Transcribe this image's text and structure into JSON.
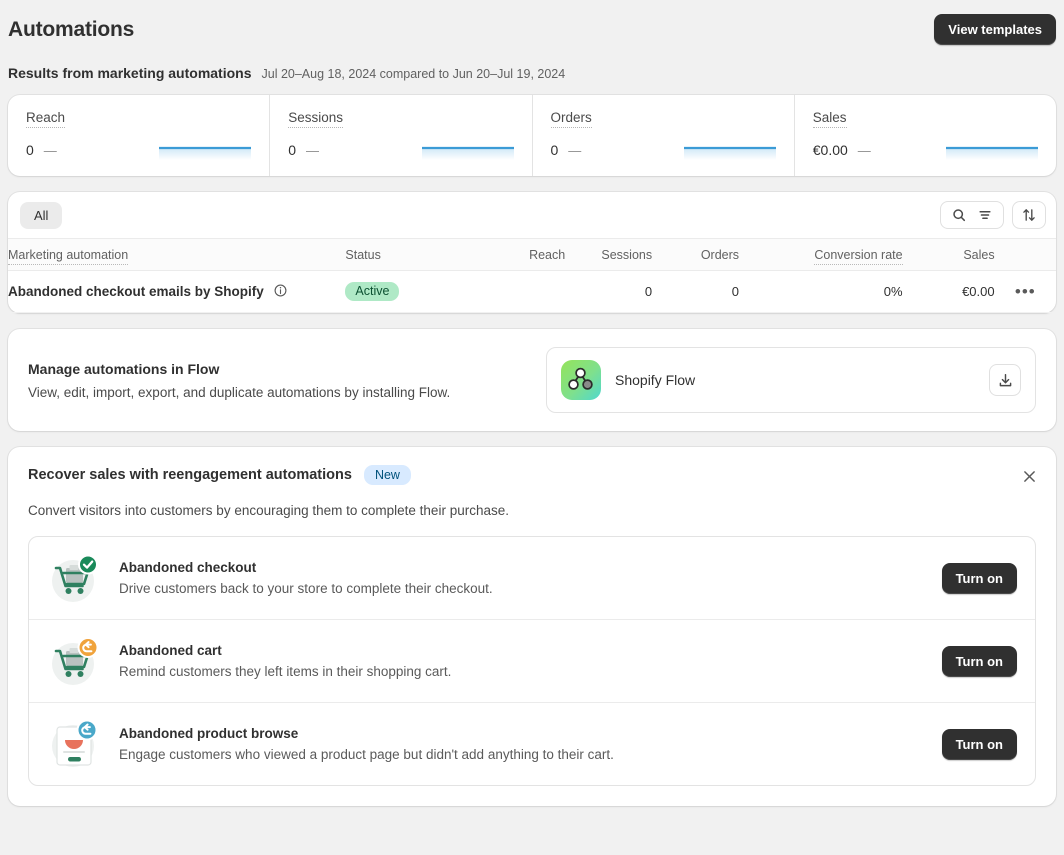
{
  "header": {
    "title": "Automations",
    "view_templates_label": "View templates"
  },
  "results": {
    "title": "Results from marketing automations",
    "date_range": "Jul 20–Aug 18, 2024 compared to Jun 20–Jul 19, 2024"
  },
  "metrics": [
    {
      "label": "Reach",
      "value": "0",
      "delta": "—"
    },
    {
      "label": "Sessions",
      "value": "0",
      "delta": "—"
    },
    {
      "label": "Orders",
      "value": "0",
      "delta": "—"
    },
    {
      "label": "Sales",
      "value": "€0.00",
      "delta": "—"
    }
  ],
  "table": {
    "tab_all": "All",
    "search_icon": "search-icon",
    "filter_icon": "filter-icon",
    "sort_icon": "sort-icon",
    "columns": {
      "name": "Marketing automation",
      "status": "Status",
      "reach": "Reach",
      "sessions": "Sessions",
      "orders": "Orders",
      "conversion_rate": "Conversion rate",
      "sales": "Sales"
    },
    "rows": [
      {
        "name": "Abandoned checkout emails by Shopify",
        "info_icon": "info-icon",
        "status": "Active",
        "reach": "",
        "sessions": "0",
        "orders": "0",
        "conversion_rate": "0%",
        "sales": "€0.00",
        "menu": "•••"
      }
    ]
  },
  "flow": {
    "title": "Manage automations in Flow",
    "subtitle": "View, edit, import, export, and duplicate automations by installing Flow.",
    "app_name": "Shopify Flow",
    "app_icon": "shopify-flow-icon",
    "download_icon": "download-icon"
  },
  "reengagement": {
    "title": "Recover sales with reengagement automations",
    "badge": "New",
    "close_icon": "close-icon",
    "subtitle": "Convert visitors into customers by encouraging them to complete their purchase.",
    "items": [
      {
        "icon": "cart-check-icon",
        "title": "Abandoned checkout",
        "subtitle": "Drive customers back to your store to complete their checkout.",
        "button": "Turn on"
      },
      {
        "icon": "cart-return-icon",
        "title": "Abandoned cart",
        "subtitle": "Remind customers they left items in their shopping cart.",
        "button": "Turn on"
      },
      {
        "icon": "product-page-return-icon",
        "title": "Abandoned product browse",
        "subtitle": "Engage customers who viewed a product page but didn't add anything to their cart.",
        "button": "Turn on"
      }
    ]
  },
  "colors": {
    "page_bg": "#f1f1f1",
    "card_bg": "#ffffff",
    "text": "#303030",
    "muted": "#616161",
    "dark_button": "#303030",
    "active_badge_bg": "#afe9c6",
    "active_badge_text": "#0c5132",
    "new_badge_bg": "#d8eaff",
    "new_badge_text": "#00527c",
    "spark_line": "#3b9bd6",
    "spark_fill": "#cfe8f7"
  }
}
